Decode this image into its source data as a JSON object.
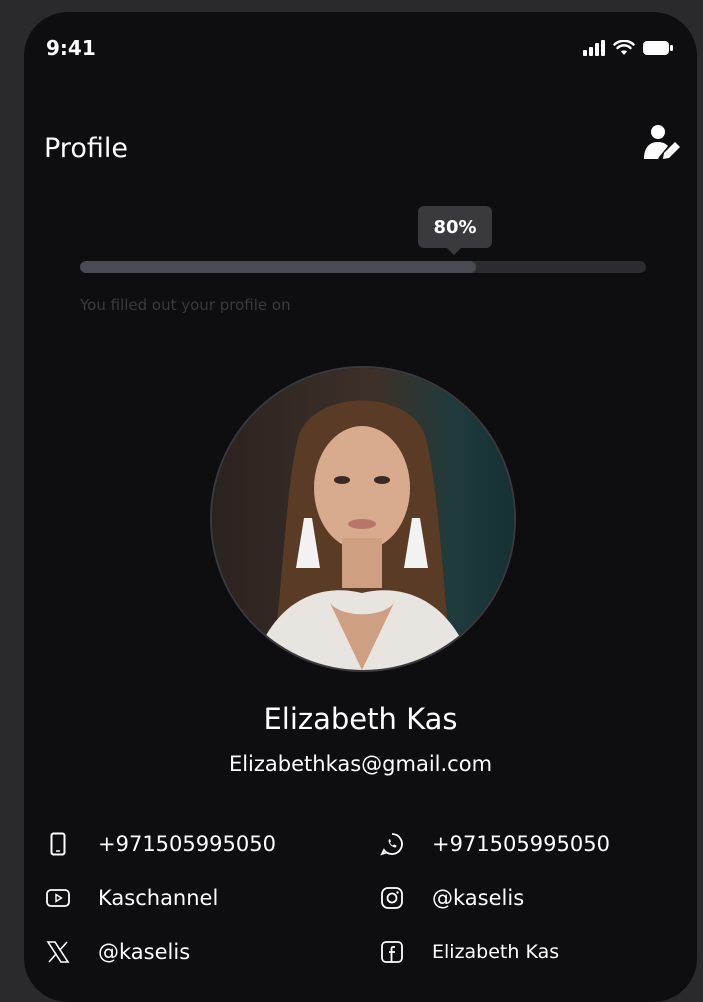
{
  "status_bar": {
    "time": "9:41",
    "icons": [
      "signal-icon",
      "wifi-icon",
      "battery-icon"
    ]
  },
  "header": {
    "title": "Profile",
    "edit_icon": "edit-profile-icon"
  },
  "progress": {
    "percent_label": "80%",
    "value": 0.7,
    "caption": "You filled out your profile on"
  },
  "profile": {
    "name": "Elizabeth Kas",
    "email": "Elizabethkas@gmail.com"
  },
  "contacts": {
    "phone": "+971505995050",
    "whatsapp": "+971505995050",
    "youtube": "Kaschannel",
    "instagram": "@kaselis",
    "x": "@kaselis",
    "facebook": "Elizabeth Kas"
  },
  "colors": {
    "background": "#0e0e10",
    "outer": "#2a2a2c",
    "text": "#ffffff",
    "track": "#2b2b30",
    "fill": "#4a4a52"
  }
}
